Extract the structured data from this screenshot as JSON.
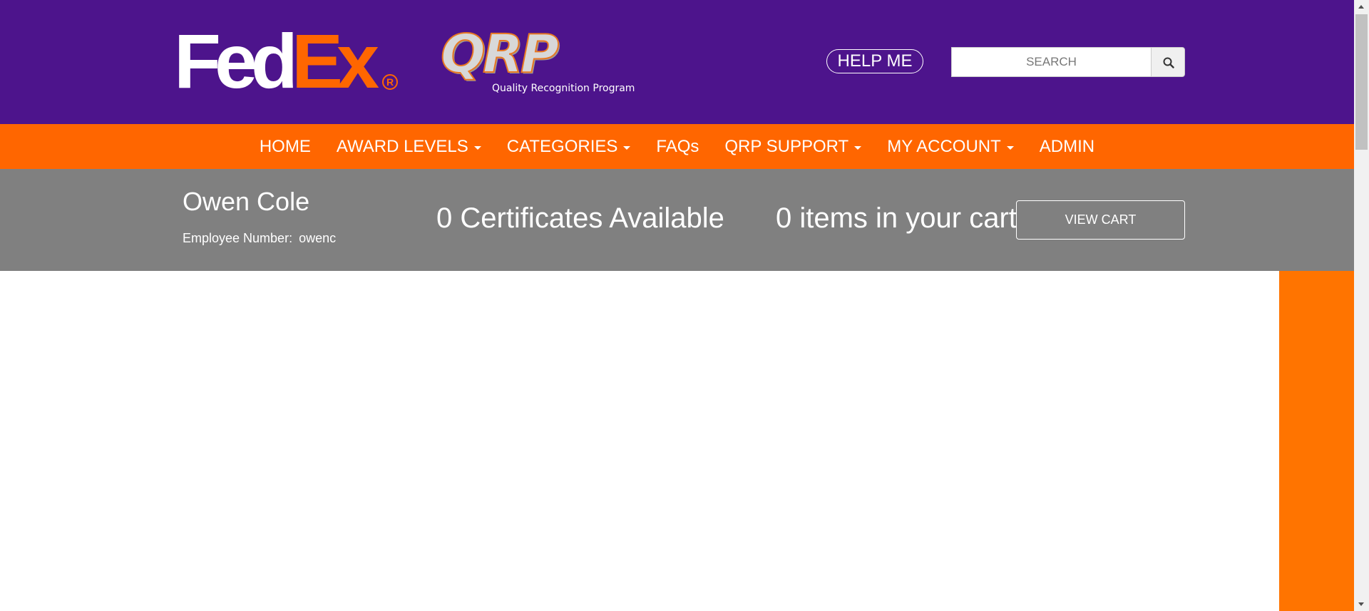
{
  "header": {
    "logo_fed": "Fed",
    "logo_ex": "Ex",
    "logo_reg": "R",
    "qrp_mark": "QRP",
    "qrp_tagline": "Quality Recognition Program",
    "help_label": "HELP ME",
    "search_placeholder": "SEARCH",
    "search_value": "",
    "search_icon": "magnifier-icon"
  },
  "nav": {
    "items": [
      {
        "label": "HOME",
        "dropdown": false
      },
      {
        "label": "AWARD LEVELS",
        "dropdown": true
      },
      {
        "label": "CATEGORIES",
        "dropdown": true
      },
      {
        "label": "FAQs",
        "dropdown": false
      },
      {
        "label": "QRP SUPPORT",
        "dropdown": true
      },
      {
        "label": "MY ACCOUNT",
        "dropdown": true
      },
      {
        "label": "ADMIN",
        "dropdown": false
      }
    ]
  },
  "user": {
    "name": "Owen Cole",
    "employee_number_label": "Employee Number:",
    "employee_number": "owenc"
  },
  "status": {
    "certificates": "0 Certificates Available",
    "cart": "0 items in your cart",
    "view_cart_label": "VIEW CART"
  },
  "colors": {
    "brand_purple": "#4d148c",
    "brand_orange": "#ff6600",
    "info_gray": "#808080"
  }
}
